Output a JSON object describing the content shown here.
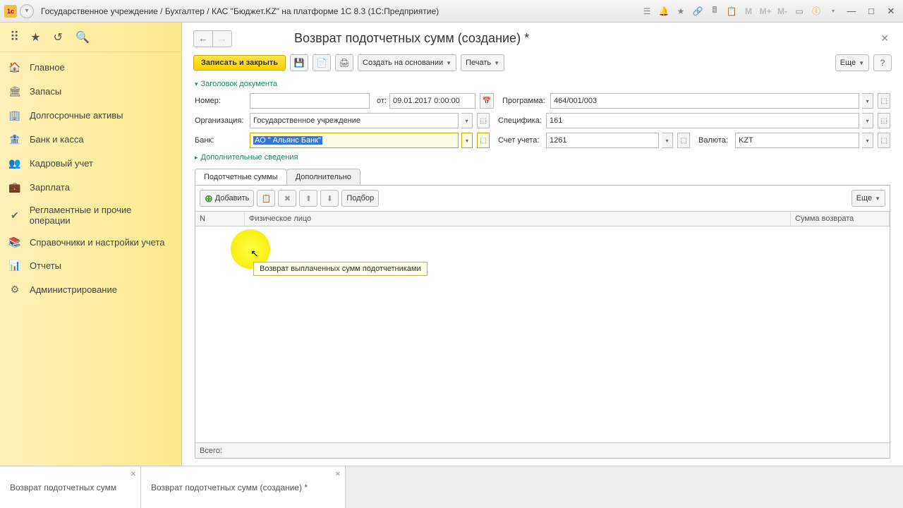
{
  "titlebar": {
    "app_name": "Государственное учреждение / Бухгалтер / КАС \"Бюджет.KZ\" на платформе 1С 8.3  (1С:Предприятие)",
    "m_labels": [
      "M",
      "M+",
      "M-"
    ]
  },
  "sidebar": {
    "items": [
      {
        "icon": "🏠",
        "label": "Главное"
      },
      {
        "icon": "🏛",
        "label": "Запасы"
      },
      {
        "icon": "🏢",
        "label": "Долгосрочные активы"
      },
      {
        "icon": "🏦",
        "label": "Банк и касса"
      },
      {
        "icon": "👥",
        "label": "Кадровый учет"
      },
      {
        "icon": "💼",
        "label": "Зарплата"
      },
      {
        "icon": "✔",
        "label": "Регламентные и прочие операции"
      },
      {
        "icon": "📚",
        "label": "Справочники и настройки учета"
      },
      {
        "icon": "📊",
        "label": "Отчеты"
      },
      {
        "icon": "⚙",
        "label": "Администрирование"
      }
    ]
  },
  "page": {
    "title": "Возврат подотчетных сумм (создание) *",
    "toolbar": {
      "save_close": "Записать и закрыть",
      "create_based": "Создать на основании",
      "print": "Печать",
      "more": "Еще"
    },
    "section_header": "Заголовок документа",
    "section_extra": "Дополнительные сведения",
    "fields": {
      "number_label": "Номер:",
      "number_value": "",
      "date_label": "от:",
      "date_value": "09.01.2017 0:00:00",
      "program_label": "Программа:",
      "program_value": "464/001/003",
      "org_label": "Организация:",
      "org_value": "Государственное учреждение",
      "spec_label": "Специфика:",
      "spec_value": "161",
      "bank_label": "Банк:",
      "bank_value": "АО \" Альянс Банк\"",
      "account_label": "Счет учета:",
      "account_value": "1261",
      "currency_label": "Валюта:",
      "currency_value": "KZT"
    },
    "tabs": {
      "tab1": "Подотчетные суммы",
      "tab2": "Дополнительно"
    },
    "table": {
      "add": "Добавить",
      "select": "Подбор",
      "more": "Еще",
      "col_n": "N",
      "col_person": "Физическое лицо",
      "col_sum": "Сумма возврата",
      "total_label": "Всего:",
      "tooltip": "Возврат выплаченных сумм подотчетниками"
    }
  },
  "bottom_tabs": {
    "tab1": "Возврат подотчетных сумм",
    "tab2": "Возврат подотчетных сумм (создание) *"
  }
}
